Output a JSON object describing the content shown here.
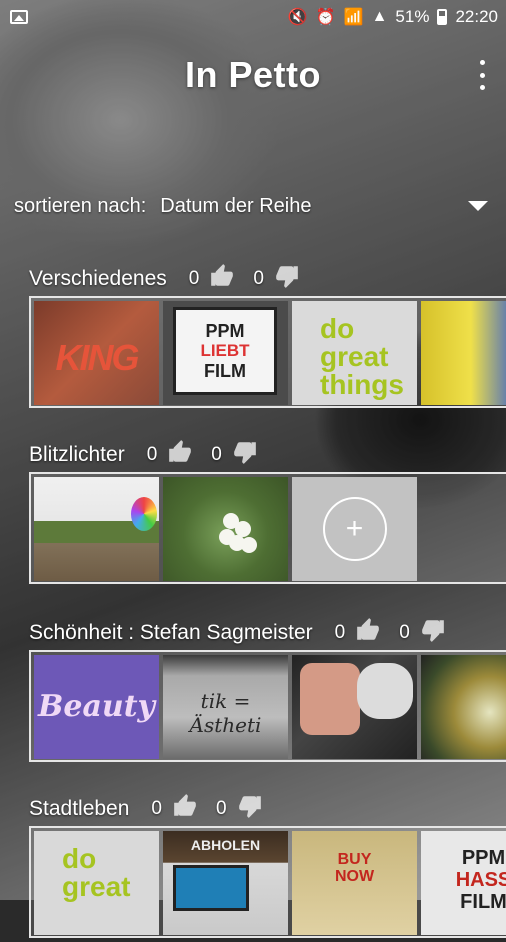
{
  "status_bar": {
    "battery_percent": "51%",
    "time": "22:20"
  },
  "app": {
    "title": "In Petto"
  },
  "sort": {
    "label": "sortieren nach:",
    "value": "Datum der Reihe"
  },
  "sections": [
    {
      "title": "Verschiedenes",
      "likes": "0",
      "dislikes": "0",
      "tiles": [
        {
          "kind": "king",
          "text": "KING"
        },
        {
          "kind": "ppm",
          "lines": [
            "PPM",
            "LIEBT",
            "FILM"
          ]
        },
        {
          "kind": "great",
          "lines": [
            "do",
            "great",
            "things"
          ]
        },
        {
          "kind": "yellow"
        }
      ]
    },
    {
      "title": "Blitzlichter",
      "likes": "0",
      "dislikes": "0",
      "tiles": [
        {
          "kind": "street"
        },
        {
          "kind": "flower"
        },
        {
          "kind": "add",
          "text": "+"
        }
      ]
    },
    {
      "title": "Schönheit : Stefan Sagmeister",
      "likes": "0",
      "dislikes": "0",
      "tiles": [
        {
          "kind": "beauty",
          "text": "Beauty"
        },
        {
          "kind": "sign",
          "text": "tik = Ästheti"
        },
        {
          "kind": "face"
        },
        {
          "kind": "peacock"
        }
      ]
    },
    {
      "title": "Stadtleben",
      "likes": "0",
      "dislikes": "0",
      "tiles": [
        {
          "kind": "green2",
          "lines": [
            "do",
            "great"
          ]
        },
        {
          "kind": "abholen",
          "text": "ABHOLEN"
        },
        {
          "kind": "buy",
          "lines": [
            "BUY",
            "NOW"
          ]
        },
        {
          "kind": "ppm2",
          "lines": [
            "PPM",
            "HASS",
            "FILM"
          ]
        }
      ]
    }
  ]
}
